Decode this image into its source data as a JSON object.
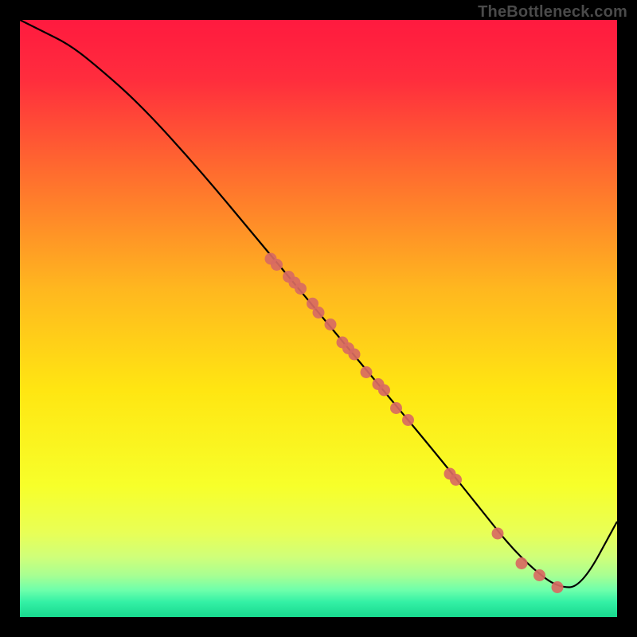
{
  "watermark": "TheBottleneck.com",
  "chart_data": {
    "type": "line",
    "title": "",
    "xlabel": "",
    "ylabel": "",
    "xlim": [
      0,
      100
    ],
    "ylim": [
      0,
      100
    ],
    "grid": false,
    "legend": false,
    "series": [
      {
        "name": "curve",
        "x": [
          0,
          4,
          8,
          12,
          20,
          30,
          40,
          50,
          60,
          70,
          78,
          82,
          86,
          90,
          94,
          100
        ],
        "y": [
          100,
          98,
          96,
          93,
          86,
          75,
          63,
          51,
          39,
          27,
          17,
          12,
          8,
          5,
          5,
          16
        ]
      }
    ],
    "points": [
      {
        "x": 42,
        "y": 60
      },
      {
        "x": 43,
        "y": 59
      },
      {
        "x": 45,
        "y": 57
      },
      {
        "x": 46,
        "y": 56
      },
      {
        "x": 47,
        "y": 55
      },
      {
        "x": 49,
        "y": 52.5
      },
      {
        "x": 50,
        "y": 51
      },
      {
        "x": 52,
        "y": 49
      },
      {
        "x": 54,
        "y": 46
      },
      {
        "x": 55,
        "y": 45
      },
      {
        "x": 56,
        "y": 44
      },
      {
        "x": 58,
        "y": 41
      },
      {
        "x": 60,
        "y": 39
      },
      {
        "x": 61,
        "y": 38
      },
      {
        "x": 63,
        "y": 35
      },
      {
        "x": 65,
        "y": 33
      },
      {
        "x": 72,
        "y": 24
      },
      {
        "x": 73,
        "y": 23
      },
      {
        "x": 80,
        "y": 14
      },
      {
        "x": 84,
        "y": 9
      },
      {
        "x": 87,
        "y": 7
      },
      {
        "x": 90,
        "y": 5
      }
    ],
    "gradient_stops": [
      {
        "offset": 0.0,
        "color": "#ff1a3f"
      },
      {
        "offset": 0.1,
        "color": "#ff2d3d"
      },
      {
        "offset": 0.25,
        "color": "#ff6a2f"
      },
      {
        "offset": 0.45,
        "color": "#ffb71f"
      },
      {
        "offset": 0.62,
        "color": "#ffe612"
      },
      {
        "offset": 0.78,
        "color": "#f7ff2a"
      },
      {
        "offset": 0.86,
        "color": "#e8ff57"
      },
      {
        "offset": 0.9,
        "color": "#cfff7a"
      },
      {
        "offset": 0.93,
        "color": "#a8ff92"
      },
      {
        "offset": 0.955,
        "color": "#6dffab"
      },
      {
        "offset": 0.975,
        "color": "#33f0a5"
      },
      {
        "offset": 1.0,
        "color": "#18d98e"
      }
    ],
    "point_color": "#d86a62",
    "line_color": "#000000"
  }
}
